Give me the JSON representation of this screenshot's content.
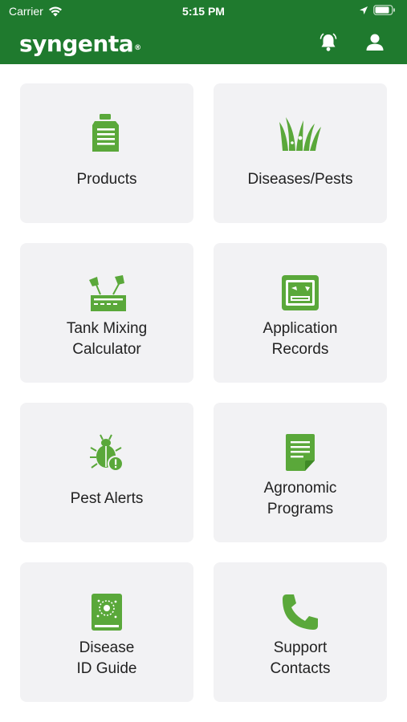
{
  "status_bar": {
    "carrier": "Carrier",
    "time": "5:15 PM"
  },
  "header": {
    "brand": "syngenta",
    "brand_mark": "®",
    "bell_icon": "bell-icon",
    "profile_icon": "user-icon"
  },
  "colors": {
    "brand_green": "#1f7a2e",
    "icon_green": "#5aa83a",
    "tile_bg": "#f2f2f4",
    "label_text": "#222222"
  },
  "tiles": [
    {
      "label": "Products",
      "icon": "jerrycan-icon"
    },
    {
      "label": "Diseases/Pests",
      "icon": "grass-pest-icon"
    },
    {
      "label": "Tank Mixing\nCalculator",
      "icon": "tank-mixing-icon"
    },
    {
      "label": "Application\nRecords",
      "icon": "application-records-icon"
    },
    {
      "label": "Pest Alerts",
      "icon": "bug-alert-icon"
    },
    {
      "label": "Agronomic\nPrograms",
      "icon": "document-icon"
    },
    {
      "label": "Disease\nID Guide",
      "icon": "disease-guide-icon"
    },
    {
      "label": "Support\nContacts",
      "icon": "phone-icon"
    }
  ]
}
